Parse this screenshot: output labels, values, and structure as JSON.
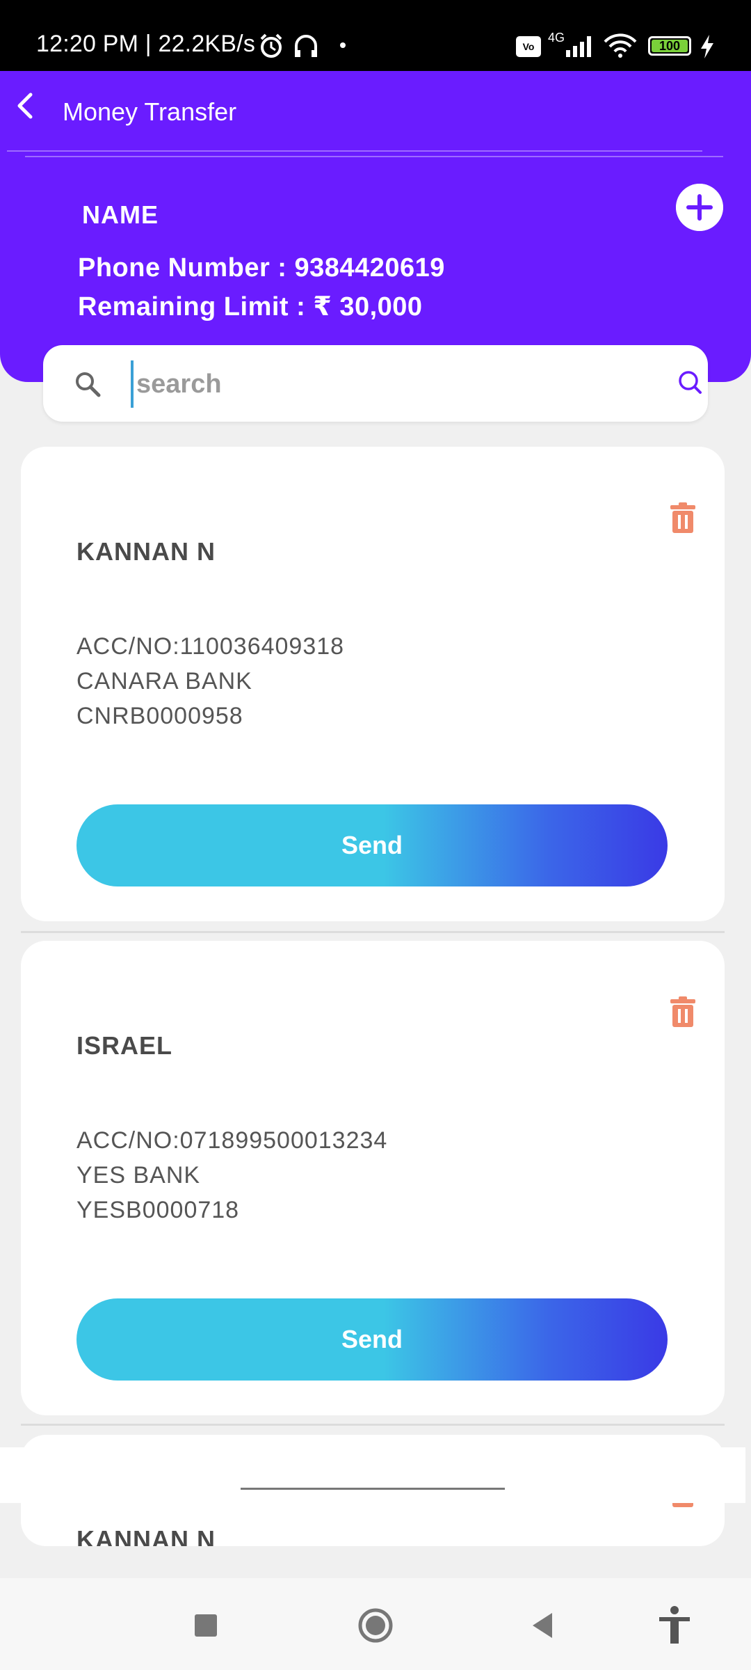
{
  "status_bar": {
    "time": "12:20 PM | 22.2KB/s",
    "network": "4G",
    "battery": "100"
  },
  "header": {
    "title": "Money Transfer",
    "customer_name": "NAME",
    "phone": "Phone Number : 9384420619",
    "limit": "Remaining Limit : ₹ 30,000"
  },
  "search": {
    "placeholder": "search",
    "value": ""
  },
  "beneficiaries": [
    {
      "name": "KANNAN N",
      "account": "ACC/NO:110036409318",
      "bank": "CANARA BANK",
      "ifsc": "CNRB0000958",
      "send_label": "Send"
    },
    {
      "name": "ISRAEL",
      "account": "ACC/NO:071899500013234",
      "bank": "YES BANK",
      "ifsc": "YESB0000718",
      "send_label": "Send"
    },
    {
      "name": "KANNAN N"
    }
  ],
  "colors": {
    "header_bg": "#6a1cff",
    "delete_icon": "#f08a6a",
    "send_gradient_start": "#3cc6e6",
    "send_gradient_end": "#3a3ae6"
  }
}
